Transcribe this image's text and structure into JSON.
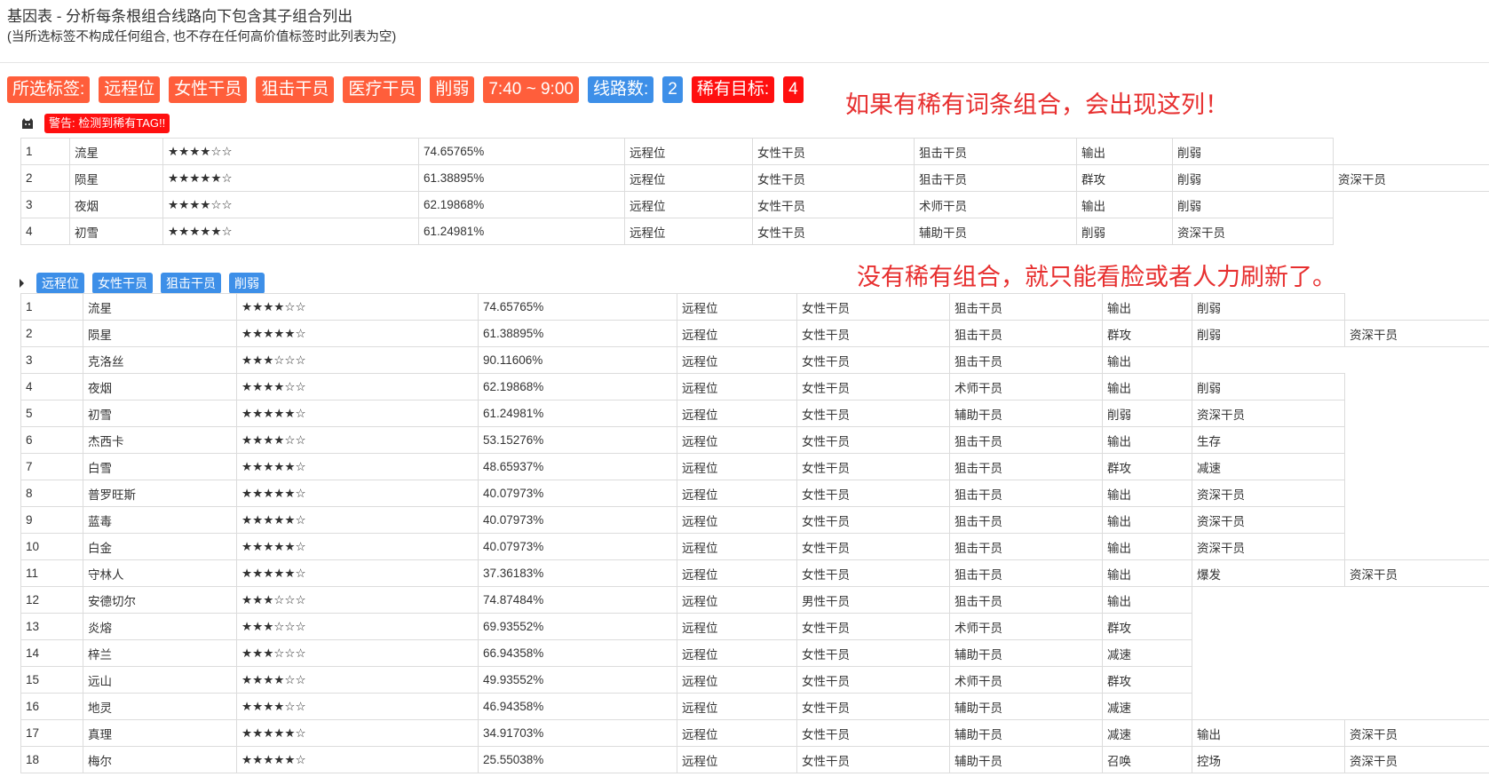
{
  "header": {
    "title": "基因表 - 分析每条根组合线路向下包含其子组合列出",
    "subtitle": "(当所选标签不构成任何组合, 也不存在任何高价值标签时此列表为空)"
  },
  "tags": {
    "selected_label": "所选标签:",
    "items": [
      "远程位",
      "女性干员",
      "狙击干员",
      "医疗干员",
      "削弱"
    ],
    "time": "7:40 ~ 9:00",
    "routes_label": "线路数:",
    "routes_count": "2",
    "rare_label": "稀有目标:",
    "rare_count": "4"
  },
  "annotations": {
    "rare_note": "如果有稀有词条组合，会出现这列！",
    "norare_note": "没有稀有组合，就只能看脸或者人力刷新了。"
  },
  "warning": {
    "text": "警告: 检测到稀有TAG!!"
  },
  "rare_table": {
    "rows": [
      {
        "no": "1",
        "name": "流星",
        "stars": "★★★★☆☆",
        "pct": "74.65765%",
        "tags": [
          {
            "t": "远程位",
            "l": true
          },
          {
            "t": "女性干员",
            "l": true
          },
          {
            "t": "狙击干员",
            "l": true
          },
          {
            "t": "输出",
            "l": false
          },
          {
            "t": "削弱",
            "l": true
          }
        ]
      },
      {
        "no": "2",
        "name": "陨星",
        "stars": "★★★★★☆",
        "pct": "61.38895%",
        "tags": [
          {
            "t": "远程位",
            "l": true
          },
          {
            "t": "女性干员",
            "l": true
          },
          {
            "t": "狙击干员",
            "l": true
          },
          {
            "t": "群攻",
            "l": false
          },
          {
            "t": "削弱",
            "l": true
          },
          {
            "t": "资深干员",
            "l": false
          }
        ]
      },
      {
        "no": "3",
        "name": "夜烟",
        "stars": "★★★★☆☆",
        "pct": "62.19868%",
        "tags": [
          {
            "t": "远程位",
            "l": true
          },
          {
            "t": "女性干员",
            "l": true
          },
          {
            "t": "术师干员",
            "l": false
          },
          {
            "t": "输出",
            "l": false
          },
          {
            "t": "削弱",
            "l": true
          }
        ]
      },
      {
        "no": "4",
        "name": "初雪",
        "stars": "★★★★★☆",
        "pct": "61.24981%",
        "tags": [
          {
            "t": "远程位",
            "l": true
          },
          {
            "t": "女性干员",
            "l": true
          },
          {
            "t": "辅助干员",
            "l": false
          },
          {
            "t": "削弱",
            "l": true
          },
          {
            "t": "资深干员",
            "l": false
          }
        ]
      }
    ]
  },
  "combo_tags": [
    "远程位",
    "女性干员",
    "狙击干员",
    "削弱"
  ],
  "main_table": {
    "rows": [
      {
        "no": "1",
        "name": "流星",
        "stars": "★★★★☆☆",
        "pct": "74.65765%",
        "tags": [
          {
            "t": "远程位",
            "l": true
          },
          {
            "t": "女性干员",
            "l": true
          },
          {
            "t": "狙击干员",
            "l": true
          },
          {
            "t": "输出",
            "l": false
          },
          {
            "t": "削弱",
            "l": true
          }
        ]
      },
      {
        "no": "2",
        "name": "陨星",
        "stars": "★★★★★☆",
        "pct": "61.38895%",
        "tags": [
          {
            "t": "远程位",
            "l": true
          },
          {
            "t": "女性干员",
            "l": true
          },
          {
            "t": "狙击干员",
            "l": true
          },
          {
            "t": "群攻",
            "l": false
          },
          {
            "t": "削弱",
            "l": true
          },
          {
            "t": "资深干员",
            "l": false
          }
        ]
      },
      {
        "no": "3",
        "name": "克洛丝",
        "stars": "★★★☆☆☆",
        "pct": "90.11606%",
        "tags": [
          {
            "t": "远程位",
            "l": true
          },
          {
            "t": "女性干员",
            "l": true
          },
          {
            "t": "狙击干员",
            "l": true
          },
          {
            "t": "输出",
            "l": false
          }
        ]
      },
      {
        "no": "4",
        "name": "夜烟",
        "stars": "★★★★☆☆",
        "pct": "62.19868%",
        "tags": [
          {
            "t": "远程位",
            "l": true
          },
          {
            "t": "女性干员",
            "l": true
          },
          {
            "t": "术师干员",
            "l": false
          },
          {
            "t": "输出",
            "l": false
          },
          {
            "t": "削弱",
            "l": true
          }
        ]
      },
      {
        "no": "5",
        "name": "初雪",
        "stars": "★★★★★☆",
        "pct": "61.24981%",
        "tags": [
          {
            "t": "远程位",
            "l": true
          },
          {
            "t": "女性干员",
            "l": true
          },
          {
            "t": "辅助干员",
            "l": false
          },
          {
            "t": "削弱",
            "l": true
          },
          {
            "t": "资深干员",
            "l": false
          }
        ]
      },
      {
        "no": "6",
        "name": "杰西卡",
        "stars": "★★★★☆☆",
        "pct": "53.15276%",
        "tags": [
          {
            "t": "远程位",
            "l": true
          },
          {
            "t": "女性干员",
            "l": true
          },
          {
            "t": "狙击干员",
            "l": true
          },
          {
            "t": "输出",
            "l": false
          },
          {
            "t": "生存",
            "l": false
          }
        ]
      },
      {
        "no": "7",
        "name": "白雪",
        "stars": "★★★★★☆",
        "pct": "48.65937%",
        "tags": [
          {
            "t": "远程位",
            "l": true
          },
          {
            "t": "女性干员",
            "l": true
          },
          {
            "t": "狙击干员",
            "l": true
          },
          {
            "t": "群攻",
            "l": false
          },
          {
            "t": "减速",
            "l": false
          }
        ]
      },
      {
        "no": "8",
        "name": "普罗旺斯",
        "stars": "★★★★★☆",
        "pct": "40.07973%",
        "tags": [
          {
            "t": "远程位",
            "l": true
          },
          {
            "t": "女性干员",
            "l": true
          },
          {
            "t": "狙击干员",
            "l": true
          },
          {
            "t": "输出",
            "l": false
          },
          {
            "t": "资深干员",
            "l": false
          }
        ]
      },
      {
        "no": "9",
        "name": "蓝毒",
        "stars": "★★★★★☆",
        "pct": "40.07973%",
        "tags": [
          {
            "t": "远程位",
            "l": true
          },
          {
            "t": "女性干员",
            "l": true
          },
          {
            "t": "狙击干员",
            "l": true
          },
          {
            "t": "输出",
            "l": false
          },
          {
            "t": "资深干员",
            "l": false
          }
        ]
      },
      {
        "no": "10",
        "name": "白金",
        "stars": "★★★★★☆",
        "pct": "40.07973%",
        "tags": [
          {
            "t": "远程位",
            "l": true
          },
          {
            "t": "女性干员",
            "l": true
          },
          {
            "t": "狙击干员",
            "l": true
          },
          {
            "t": "输出",
            "l": false
          },
          {
            "t": "资深干员",
            "l": false
          }
        ]
      },
      {
        "no": "11",
        "name": "守林人",
        "stars": "★★★★★☆",
        "pct": "37.36183%",
        "tags": [
          {
            "t": "远程位",
            "l": true
          },
          {
            "t": "女性干员",
            "l": true
          },
          {
            "t": "狙击干员",
            "l": true
          },
          {
            "t": "输出",
            "l": false
          },
          {
            "t": "爆发",
            "l": false
          },
          {
            "t": "资深干员",
            "l": false
          }
        ]
      },
      {
        "no": "12",
        "name": "安德切尔",
        "stars": "★★★☆☆☆",
        "pct": "74.87484%",
        "tags": [
          {
            "t": "远程位",
            "l": true
          },
          {
            "t": "男性干员",
            "l": false
          },
          {
            "t": "狙击干员",
            "l": true
          },
          {
            "t": "输出",
            "l": false
          }
        ]
      },
      {
        "no": "13",
        "name": "炎熔",
        "stars": "★★★☆☆☆",
        "pct": "69.93552%",
        "tags": [
          {
            "t": "远程位",
            "l": true
          },
          {
            "t": "女性干员",
            "l": true
          },
          {
            "t": "术师干员",
            "l": false
          },
          {
            "t": "群攻",
            "l": false
          }
        ]
      },
      {
        "no": "14",
        "name": "梓兰",
        "stars": "★★★☆☆☆",
        "pct": "66.94358%",
        "tags": [
          {
            "t": "远程位",
            "l": true
          },
          {
            "t": "女性干员",
            "l": true
          },
          {
            "t": "辅助干员",
            "l": false
          },
          {
            "t": "减速",
            "l": false
          }
        ]
      },
      {
        "no": "15",
        "name": "远山",
        "stars": "★★★★☆☆",
        "pct": "49.93552%",
        "tags": [
          {
            "t": "远程位",
            "l": true
          },
          {
            "t": "女性干员",
            "l": true
          },
          {
            "t": "术师干员",
            "l": false
          },
          {
            "t": "群攻",
            "l": false
          }
        ]
      },
      {
        "no": "16",
        "name": "地灵",
        "stars": "★★★★☆☆",
        "pct": "46.94358%",
        "tags": [
          {
            "t": "远程位",
            "l": true
          },
          {
            "t": "女性干员",
            "l": true
          },
          {
            "t": "辅助干员",
            "l": false
          },
          {
            "t": "减速",
            "l": false
          }
        ]
      },
      {
        "no": "17",
        "name": "真理",
        "stars": "★★★★★☆",
        "pct": "34.91703%",
        "tags": [
          {
            "t": "远程位",
            "l": true
          },
          {
            "t": "女性干员",
            "l": true
          },
          {
            "t": "辅助干员",
            "l": false
          },
          {
            "t": "减速",
            "l": false
          },
          {
            "t": "输出",
            "l": false
          },
          {
            "t": "资深干员",
            "l": false
          }
        ]
      },
      {
        "no": "18",
        "name": "梅尔",
        "stars": "★★★★★☆",
        "pct": "25.55038%",
        "tags": [
          {
            "t": "远程位",
            "l": true
          },
          {
            "t": "女性干员",
            "l": true
          },
          {
            "t": "辅助干员",
            "l": false
          },
          {
            "t": "召唤",
            "l": false
          },
          {
            "t": "控场",
            "l": false
          },
          {
            "t": "资深干员",
            "l": false
          }
        ]
      }
    ]
  }
}
